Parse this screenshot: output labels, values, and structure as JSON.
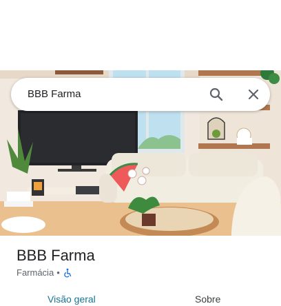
{
  "search": {
    "query": "BBB Farma",
    "search_icon": "search-icon",
    "clear_icon": "close-icon"
  },
  "place": {
    "name": "BBB Farma",
    "category": "Farmácia",
    "separator": "•",
    "accessibility_icon": "wheelchair-icon"
  },
  "tabs": [
    {
      "label": "Visão geral",
      "active": true
    },
    {
      "label": "Sobre",
      "active": false
    }
  ],
  "colors": {
    "accent": "#167495",
    "accessibility": "#1a73e8"
  }
}
